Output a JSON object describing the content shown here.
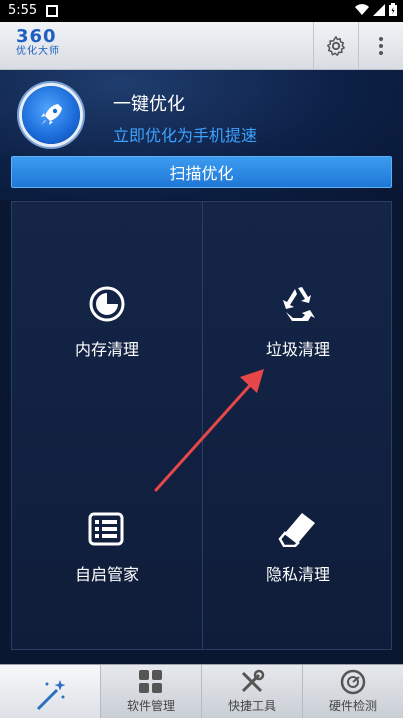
{
  "status_bar": {
    "time": "5:55"
  },
  "app": {
    "logo_number": "360",
    "logo_text": "优化大师",
    "icons": [
      "gear-icon",
      "more-vert-icon"
    ]
  },
  "hero": {
    "title": "一键优化",
    "subtitle": "立即优化为手机提速",
    "scan_button": "扫描优化",
    "icon": "rocket-icon"
  },
  "grid": {
    "items": [
      {
        "label": "内存清理",
        "icon": "memory-icon"
      },
      {
        "label": "垃圾清理",
        "icon": "recycle-icon"
      },
      {
        "label": "自启管家",
        "icon": "list-icon"
      },
      {
        "label": "隐私清理",
        "icon": "eraser-icon"
      }
    ]
  },
  "annotation": {
    "arrow_color": "#e8474a",
    "points_to": "垃圾清理"
  },
  "bottom_tabs": [
    {
      "label": "",
      "icon": "magic-wand-icon",
      "active": true
    },
    {
      "label": "软件管理",
      "icon": "apps-icon",
      "active": false
    },
    {
      "label": "快捷工具",
      "icon": "tools-icon",
      "active": false
    },
    {
      "label": "硬件检测",
      "icon": "gauge-icon",
      "active": false
    }
  ],
  "colors": {
    "accent": "#3da2ff",
    "button": "#2a86e0",
    "background": "#0a1730"
  }
}
